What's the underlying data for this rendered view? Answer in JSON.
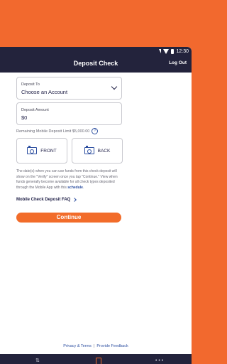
{
  "status_bar": {
    "time": "12:30"
  },
  "app_bar": {
    "title": "Deposit Check",
    "logout_label": "Log Out"
  },
  "deposit_to": {
    "label": "Deposit To",
    "value": "Choose an Account"
  },
  "deposit_amount": {
    "label": "Deposit Amount",
    "value": "$0"
  },
  "remaining_limit": "Remaining Mobile Deposit Limit $5,000.00",
  "capture": {
    "front_label": "FRONT",
    "back_label": "BACK"
  },
  "disclaimer": {
    "text": "The date(s) when you can use funds from this check deposit will show on the \"Verify\" screen once you tap \"Continue.\" View when funds generally become available for all check types deposited through the Mobile App with this",
    "link": "schedule",
    "end": "."
  },
  "faq_link": "Mobile Check Deposit FAQ",
  "continue_label": "Continue",
  "footer": {
    "privacy": "Privacy & Terms",
    "separator": "|",
    "feedback": "Provide Feedback"
  },
  "bottom_nav": {
    "more": "• • •"
  },
  "colors": {
    "brand_orange": "#f26c2a",
    "nav_dark": "#23233c",
    "link_blue": "#2d4fa0"
  }
}
